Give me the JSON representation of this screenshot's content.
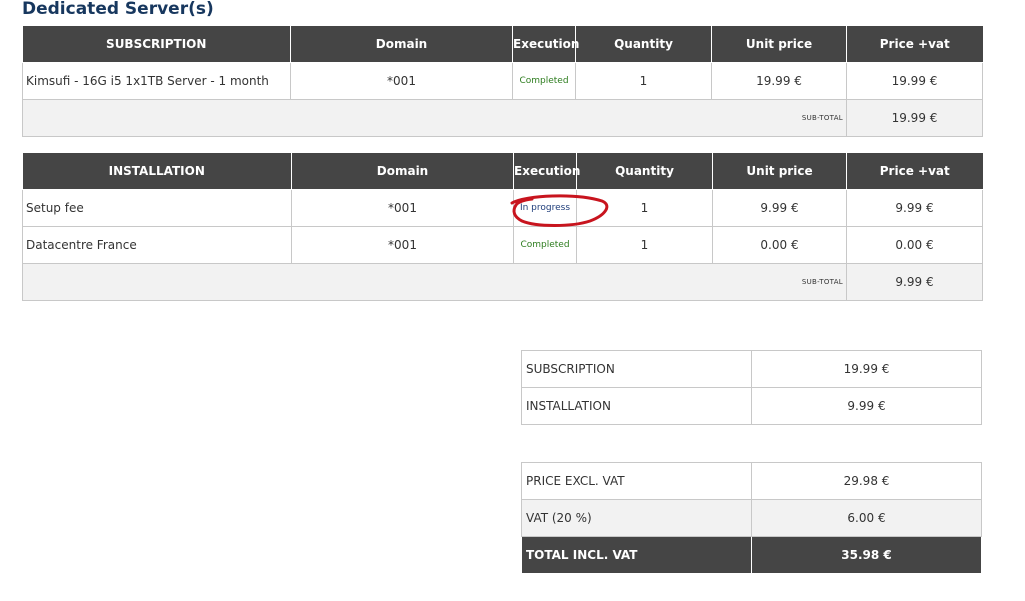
{
  "page_title": "Dedicated Server(s)",
  "subscription_table": {
    "headers": [
      "SUBSCRIPTION",
      "Domain",
      "Execution",
      "Quantity",
      "Unit price",
      "Price +vat"
    ],
    "rows": [
      {
        "name": "Kimsufi - 16G i5 1x1TB Server - 1 month",
        "domain": "*001",
        "execution": "Completed",
        "quantity": "1",
        "unit_price": "19.99 €",
        "price_vat": "19.99 €"
      }
    ],
    "subtotal_label": "SUB-TOTAL",
    "subtotal_value": "19.99 €"
  },
  "installation_table": {
    "headers": [
      "INSTALLATION",
      "Domain",
      "Execution",
      "Quantity",
      "Unit price",
      "Price +vat"
    ],
    "rows": [
      {
        "name": "Setup fee",
        "domain": "*001",
        "execution": "In progress",
        "quantity": "1",
        "unit_price": "9.99 €",
        "price_vat": "9.99 €"
      },
      {
        "name": "Datacentre France",
        "domain": "*001",
        "execution": "Completed",
        "quantity": "1",
        "unit_price": "0.00 €",
        "price_vat": "0.00 €"
      }
    ],
    "subtotal_label": "SUB-TOTAL",
    "subtotal_value": "9.99 €"
  },
  "category_summary": [
    {
      "label": "SUBSCRIPTION",
      "value": "19.99 €"
    },
    {
      "label": "INSTALLATION",
      "value": "9.99 €"
    }
  ],
  "totals": {
    "excl_vat_label": "PRICE EXCL. VAT",
    "excl_vat_value": "29.98 €",
    "vat_label": "VAT (20 %)",
    "vat_value": "6.00 €",
    "total_label": "TOTAL INCL. VAT",
    "total_value": "35.98 €"
  },
  "colors": {
    "header_bg": "#454545",
    "title": "#17375e",
    "completed": "#2e7d1f",
    "in_progress": "#1f3d7a",
    "annotation": "#c8141e"
  }
}
